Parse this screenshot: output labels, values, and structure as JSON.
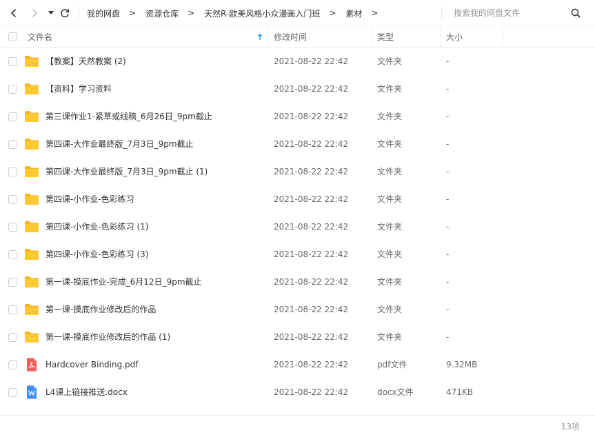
{
  "toolbar": {
    "back_icon": "chevron-left-icon",
    "forward_icon": "chevron-right-icon",
    "history_icon": "caret-down-icon",
    "refresh_icon": "refresh-icon",
    "breadcrumb": [
      "我的网盘",
      "资源仓库",
      "天然R-欧美风格小众漫画入门班",
      "素材"
    ],
    "separator": ">",
    "search_placeholder": "搜索我的网盘文件",
    "search_icon": "search-icon"
  },
  "columns": {
    "name": "文件名",
    "modified": "修改时间",
    "type": "类型",
    "size": "大小",
    "sort_icon": "sort-arrow-up-icon"
  },
  "files": [
    {
      "name": "【教案】天然教案 (2)",
      "modified": "2021-08-22 22:42",
      "type": "文件夹",
      "size": "-",
      "icon": "folder-icon"
    },
    {
      "name": "【资料】学习资料",
      "modified": "2021-08-22 22:42",
      "type": "文件夹",
      "size": "-",
      "icon": "folder-icon"
    },
    {
      "name": "第三课作业1-紧草或线稿_6月26日_9pm截止",
      "modified": "2021-08-22 22:42",
      "type": "文件夹",
      "size": "-",
      "icon": "folder-icon"
    },
    {
      "name": "第四课-大作业最终版_7月3日_9pm截止",
      "modified": "2021-08-22 22:42",
      "type": "文件夹",
      "size": "-",
      "icon": "folder-icon"
    },
    {
      "name": "第四课-大作业最终版_7月3日_9pm截止 (1)",
      "modified": "2021-08-22 22:42",
      "type": "文件夹",
      "size": "-",
      "icon": "folder-icon"
    },
    {
      "name": "第四课-小作业-色彩练习",
      "modified": "2021-08-22 22:42",
      "type": "文件夹",
      "size": "-",
      "icon": "folder-icon"
    },
    {
      "name": "第四课-小作业-色彩练习 (1)",
      "modified": "2021-08-22 22:42",
      "type": "文件夹",
      "size": "-",
      "icon": "folder-icon"
    },
    {
      "name": "第四课-小作业-色彩练习 (3)",
      "modified": "2021-08-22 22:42",
      "type": "文件夹",
      "size": "-",
      "icon": "folder-icon"
    },
    {
      "name": "第一课-摸底作业-完成_6月12日_9pm截止",
      "modified": "2021-08-22 22:42",
      "type": "文件夹",
      "size": "-",
      "icon": "folder-icon"
    },
    {
      "name": "第一课-摸底作业修改后的作品",
      "modified": "2021-08-22 22:42",
      "type": "文件夹",
      "size": "-",
      "icon": "folder-icon"
    },
    {
      "name": "第一课-摸底作业修改后的作品 (1)",
      "modified": "2021-08-22 22:42",
      "type": "文件夹",
      "size": "-",
      "icon": "folder-icon"
    },
    {
      "name": "Hardcover Binding.pdf",
      "modified": "2021-08-22 22:42",
      "type": "pdf文件",
      "size": "9.32MB",
      "icon": "pdf-file-icon"
    },
    {
      "name": "L4课上链接推送.docx",
      "modified": "2021-08-22 22:42",
      "type": "docx文件",
      "size": "471KB",
      "icon": "word-file-icon"
    }
  ],
  "footer": {
    "count": "13项"
  },
  "colors": {
    "folder": "#FFC933",
    "folder_tab": "#F5B623",
    "pdf": "#EE5F5B",
    "word": "#3E8CF5",
    "sort_arrow": "#2F8CF0",
    "border": "#EEEEEE"
  }
}
